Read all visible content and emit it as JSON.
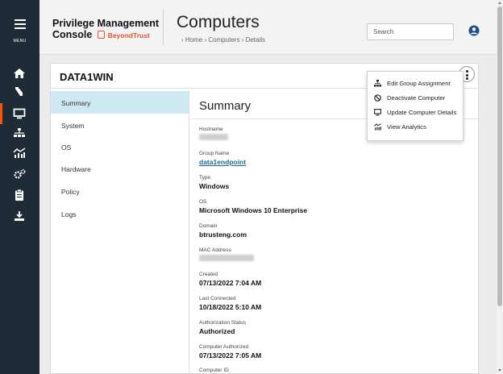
{
  "rail": {
    "menu_label": "MENU",
    "icons": [
      "home-icon",
      "policy-icon",
      "computer-icon",
      "groups-icon",
      "analytics-icon",
      "configuration-icon",
      "clipboard-icon",
      "download-icon"
    ],
    "active": "computer-icon",
    "accent": "#ff5500"
  },
  "header": {
    "brand_line1": "Privilege Management",
    "brand_line2": "Console",
    "brand_logo": "BeyondTrust",
    "title": "Computers",
    "breadcrumb": "› Home › Computers › Details",
    "search_placeholder": "Search"
  },
  "card": {
    "title": "DATA1WIN",
    "nav": [
      "Summary",
      "System",
      "OS",
      "Hardware",
      "Policy",
      "Logs"
    ],
    "selected_nav": "Summary"
  },
  "summary": {
    "title": "Summary",
    "fields": {
      "hostname_label": "Hostname",
      "group_label": "Group Name",
      "group_value": "data1endpoint",
      "type_label": "Type",
      "type_value": "Windows",
      "os_label": "OS",
      "os_value": "Microsoft Windows 10 Enterprise",
      "domain_label": "Domain",
      "domain_value": "btrusteng.com",
      "mac_label": "MAC Address",
      "created_label": "Created",
      "created_value": "07/13/2022 7:04 AM",
      "last_connected_label": "Last Connected",
      "last_connected_value": "10/18/2022 5:10 AM",
      "auth_status_label": "Authorization Status",
      "auth_status_value": "Authorized",
      "computer_authorized_label": "Computer Authorized",
      "computer_authorized_value": "07/13/2022 7:05 AM",
      "computer_id_label": "Computer ID"
    }
  },
  "dropdown": {
    "items": [
      {
        "label": "Edit Group Assignment",
        "icon": "sitemap-icon"
      },
      {
        "label": "Deactivate Computer",
        "icon": "ban-icon"
      },
      {
        "label": "Update Computer Details",
        "icon": "monitor-icon"
      },
      {
        "label": "View Analytics",
        "icon": "analytics-icon"
      }
    ]
  },
  "colors": {
    "rail_bg": "#1f2b37",
    "link": "#1a6c8c",
    "selected_nav_bg": "#cfe9f3",
    "brand_orange": "#e8552c",
    "user_icon": "#1a4f8b"
  }
}
